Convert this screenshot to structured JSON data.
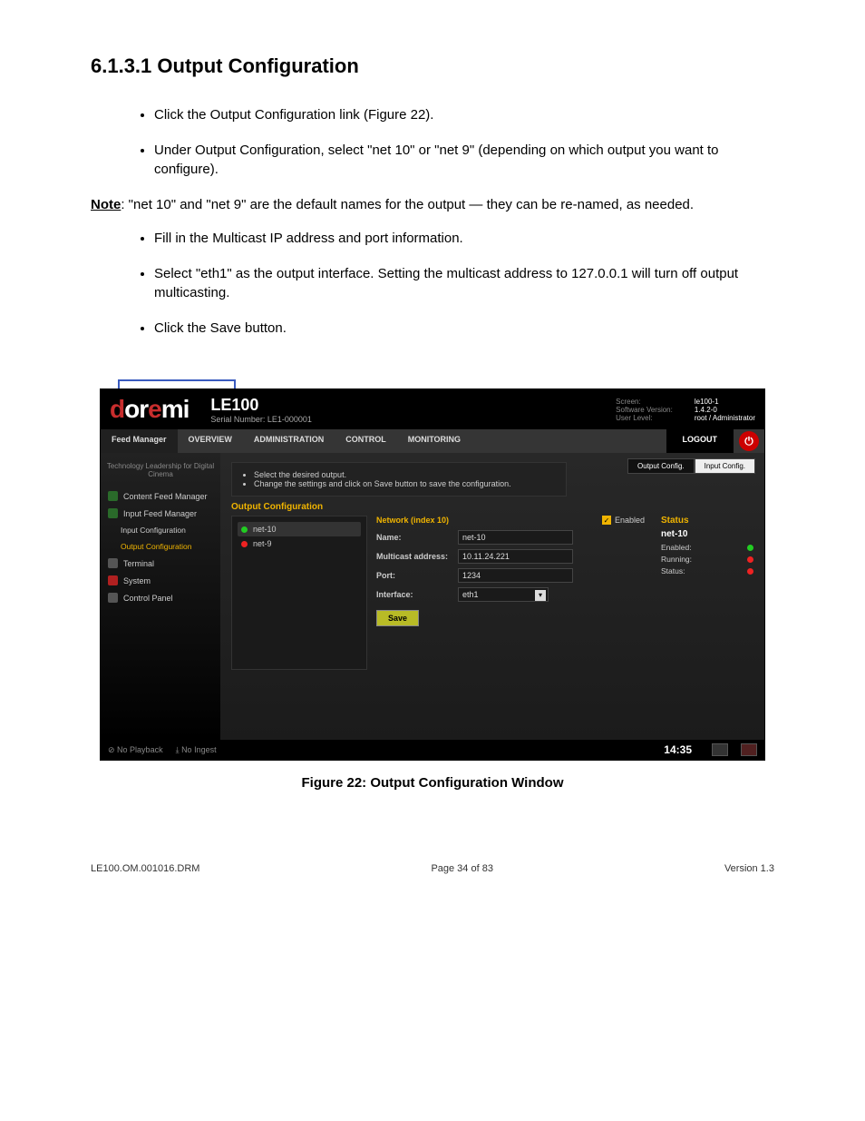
{
  "section_heading": "6.1.3.1 Output Configuration",
  "bullets1": [
    "Click the Output Configuration link (Figure 22).",
    "Under Output Configuration, select \"net 10\" or \"net 9\" (depending on which output you want to configure)."
  ],
  "note_label": "Note",
  "note_text": ": \"net 10\" and \"net 9\" are the default names for the output — they can be re-named, as needed.",
  "bullets2": [
    "Fill in the Multicast IP address and port information.",
    "Select \"eth1\" as the output interface. Setting the multicast address to 127.0.0.1 will turn off output multicasting.",
    "Click the Save button."
  ],
  "callout": "Output Configuration",
  "app": {
    "logo": "doremi",
    "prod_name": "LE100",
    "serial": "Serial Number: LE1-000001",
    "sys": {
      "screen_l": "Screen:",
      "screen_v": "le100-1",
      "sw_l": "Software Version:",
      "sw_v": "1.4.2-0",
      "ul_l": "User Level:",
      "ul_v": "root / Administrator"
    },
    "tabs": [
      "Feed Manager",
      "OVERVIEW",
      "ADMINISTRATION",
      "CONTROL",
      "MONITORING"
    ],
    "logout": "LOGOUT",
    "tagline": "Technology Leadership for Digital Cinema",
    "nav": [
      {
        "label": "Content Feed Manager"
      },
      {
        "label": "Input Feed Manager"
      },
      {
        "label": "Input Configuration",
        "sub": true
      },
      {
        "label": "Output Configuration",
        "sub": true,
        "active": true
      },
      {
        "label": "Terminal"
      },
      {
        "label": "System"
      },
      {
        "label": "Control Panel"
      }
    ],
    "toggle": {
      "out": "Output Config.",
      "in": "Input Config."
    },
    "info": [
      "Select the desired output.",
      "Change the settings and click on Save button to save the configuration."
    ],
    "sec_title": "Output Configuration",
    "outputs": [
      {
        "name": "net-10",
        "on": true
      },
      {
        "name": "net-9",
        "on": false
      }
    ],
    "form": {
      "head": "Network (index 10)",
      "enabled": "Enabled",
      "fields": {
        "name_l": "Name:",
        "name_v": "net-10",
        "mcast_l": "Multicast address:",
        "mcast_v": "10.11.24.221",
        "port_l": "Port:",
        "port_v": "1234",
        "if_l": "Interface:",
        "if_v": "eth1"
      },
      "save": "Save"
    },
    "status": {
      "title": "Status",
      "name": "net-10",
      "rows": [
        {
          "l": "Enabled:",
          "c": "g"
        },
        {
          "l": "Running:",
          "c": "r"
        },
        {
          "l": "Status:",
          "c": "r"
        }
      ]
    },
    "footer": {
      "pb": "No Playback",
      "ing": "No Ingest",
      "time": "14:35"
    }
  },
  "figcap": "Figure 22: Output Configuration Window",
  "pgfoot": {
    "l": "LE100.OM.001016.DRM",
    "c": "Page 34 of 83",
    "r": "Version 1.3"
  }
}
